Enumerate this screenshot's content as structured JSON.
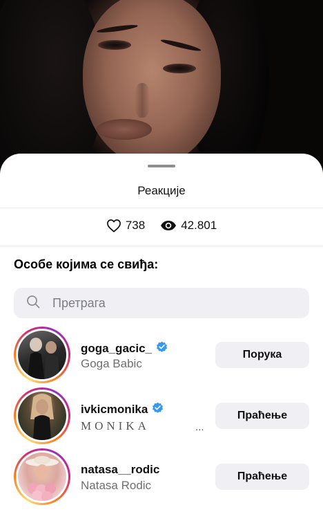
{
  "sheet": {
    "title": "Реакције",
    "stats": {
      "likes": "738",
      "views": "42.801"
    },
    "section_heading": "Особе којима се свиђа:",
    "search": {
      "placeholder": "Претрага"
    }
  },
  "users": [
    {
      "username": "goga_gacic_",
      "full_name": "Goga Babic",
      "verified": true,
      "action": "Порука"
    },
    {
      "username": "ivkicmonika",
      "full_name": "MONIKA",
      "verified": true,
      "action": "Праћење",
      "truncated": "..."
    },
    {
      "username": "natasa__rodic",
      "full_name": "Natasa Rodic",
      "verified": false,
      "action": "Праћење"
    }
  ],
  "colors": {
    "verified_blue": "#3897f0",
    "button_bg": "#efeff4",
    "ring_gradient": [
      "#feda75",
      "#fa7e1e",
      "#d62976",
      "#962fbf"
    ]
  },
  "icons": {
    "likes": "heart-icon",
    "views": "eye-icon",
    "search": "search-icon",
    "verified": "verified-badge-icon"
  }
}
